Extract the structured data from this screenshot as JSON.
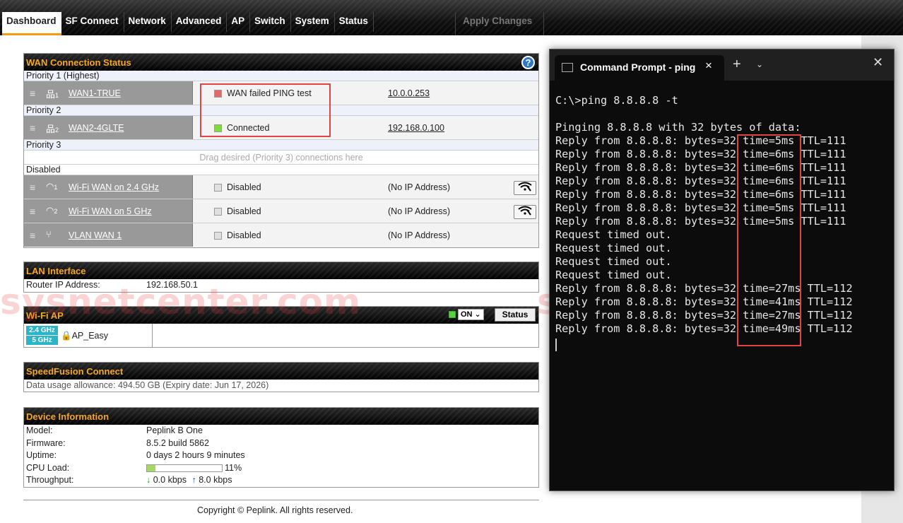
{
  "nav": {
    "tabs": [
      "Dashboard",
      "SF Connect",
      "Network",
      "Advanced",
      "AP",
      "Switch",
      "System",
      "Status"
    ],
    "apply": "Apply Changes"
  },
  "wan": {
    "title": "WAN Connection Status",
    "help": "?",
    "p1": "Priority 1 (Highest)",
    "p2": "Priority 2",
    "p3": "Priority 3",
    "disabled_label": "Disabled",
    "drop": "Drag desired (Priority 3) connections here",
    "rows": [
      {
        "num": "1",
        "name": "WAN1-TRUE",
        "status": "WAN failed PING test",
        "ip": "10.0.0.253",
        "dot": "#e06a6a"
      },
      {
        "num": "2",
        "name": "WAN2-4GLTE",
        "status": "Connected",
        "ip": "192.168.0.100",
        "dot": "#7fdc3c"
      },
      {
        "num": "1",
        "name": "Wi-Fi WAN on 2.4 GHz",
        "status": "Disabled",
        "ip": "(No IP Address)",
        "dot": "#e0e0e0"
      },
      {
        "num": "2",
        "name": "Wi-Fi WAN on 5 GHz",
        "status": "Disabled",
        "ip": "(No IP Address)",
        "dot": "#e0e0e0"
      },
      {
        "num": "",
        "name": "VLAN WAN 1",
        "status": "Disabled",
        "ip": "(No IP Address)",
        "dot": "#e0e0e0"
      }
    ]
  },
  "lan": {
    "title": "LAN Interface",
    "label": "Router IP Address:",
    "value": "192.168.50.1"
  },
  "wifi": {
    "title": "Wi-Fi AP",
    "on": "ON",
    "status_btn": "Status",
    "band1": "2.4 GHz",
    "band2": "5 GHz",
    "ssid": "AP_Easy"
  },
  "sf": {
    "title": "SpeedFusion Connect",
    "usage": "Data usage allowance: 494.50 GB (Expiry date: Jun 17, 2026)"
  },
  "device": {
    "title": "Device Information",
    "model_l": "Model:",
    "model": "Peplink B One",
    "fw_l": "Firmware:",
    "fw": "8.5.2 build 5862",
    "up_l": "Uptime:",
    "up": "0 days 2 hours 9 minutes",
    "cpu_l": "CPU Load:",
    "cpu": "11%",
    "cpu_fraction": 0.11,
    "tp_l": "Throughput:",
    "down": "0.0 kbps",
    "upk": "8.0 kbps"
  },
  "footer": "Copyright © Peplink. All rights reserved.",
  "watermark": "sysnetcenter.com",
  "watermark2": "sysnetcenter.c",
  "terminal": {
    "title": "Command Prompt - ping",
    "lines": [
      "C:\\>ping 8.8.8.8 -t",
      "",
      "Pinging 8.8.8.8 with 32 bytes of data:",
      "Reply from 8.8.8.8: bytes=32 time=5ms TTL=111",
      "Reply from 8.8.8.8: bytes=32 time=6ms TTL=111",
      "Reply from 8.8.8.8: bytes=32 time=6ms TTL=111",
      "Reply from 8.8.8.8: bytes=32 time=6ms TTL=111",
      "Reply from 8.8.8.8: bytes=32 time=6ms TTL=111",
      "Reply from 8.8.8.8: bytes=32 time=5ms TTL=111",
      "Reply from 8.8.8.8: bytes=32 time=5ms TTL=111",
      "Request timed out.",
      "Request timed out.",
      "Request timed out.",
      "Request timed out.",
      "Reply from 8.8.8.8: bytes=32 time=27ms TTL=112",
      "Reply from 8.8.8.8: bytes=32 time=41ms TTL=112",
      "Reply from 8.8.8.8: bytes=32 time=27ms TTL=112",
      "Reply from 8.8.8.8: bytes=32 time=49ms TTL=112"
    ]
  }
}
